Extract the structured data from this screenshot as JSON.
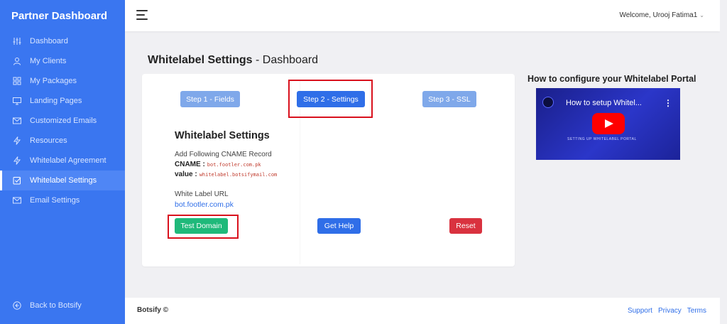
{
  "sidebar": {
    "brand": "Partner Dashboard",
    "items": [
      {
        "label": "Dashboard",
        "icon": "sliders-icon"
      },
      {
        "label": "My Clients",
        "icon": "user-icon"
      },
      {
        "label": "My Packages",
        "icon": "grid-icon"
      },
      {
        "label": "Landing Pages",
        "icon": "monitor-icon"
      },
      {
        "label": "Customized Emails",
        "icon": "mail-icon"
      },
      {
        "label": "Resources",
        "icon": "lightning-icon"
      },
      {
        "label": "Whitelabel Agreement",
        "icon": "lightning-icon"
      },
      {
        "label": "Whitelabel Settings",
        "icon": "checkbox-icon",
        "active": true
      },
      {
        "label": "Email Settings",
        "icon": "mail-icon"
      }
    ],
    "back_label": "Back to Botsify"
  },
  "topbar": {
    "welcome": "Welcome, Urooj Fatima1"
  },
  "page": {
    "title_bold": "Whitelabel Settings",
    "title_rest": " - Dashboard"
  },
  "steps": {
    "step1": "Step 1 - Fields",
    "step2": "Step 2 - Settings",
    "step3": "Step 3 - SSL"
  },
  "settings": {
    "heading": "Whitelabel Settings",
    "cname_intro": "Add Following CNAME Record",
    "cname_label": "CNAME :",
    "cname_value": "bot.footler.com.pk",
    "value_label": "value :",
    "value_value": "whitelabel.botsifymail.com",
    "url_label": "White Label URL",
    "url_value": "bot.footler.com.pk"
  },
  "actions": {
    "test_domain": "Test Domain",
    "get_help": "Get Help",
    "reset": "Reset"
  },
  "colors": {
    "sidebar": "#3a76f0",
    "primary": "#2f6ee8",
    "success": "#1fb97a",
    "danger": "#d9323f",
    "highlight": "#d9111d"
  },
  "video": {
    "heading": "How to configure your Whitelabel Portal",
    "title": "How to setup Whitel...",
    "overlay_text": "SETTING UP WHITELABEL PORTAL"
  },
  "footer": {
    "brand": "Botsify ©",
    "links": [
      "Support",
      "Privacy",
      "Terms"
    ]
  }
}
